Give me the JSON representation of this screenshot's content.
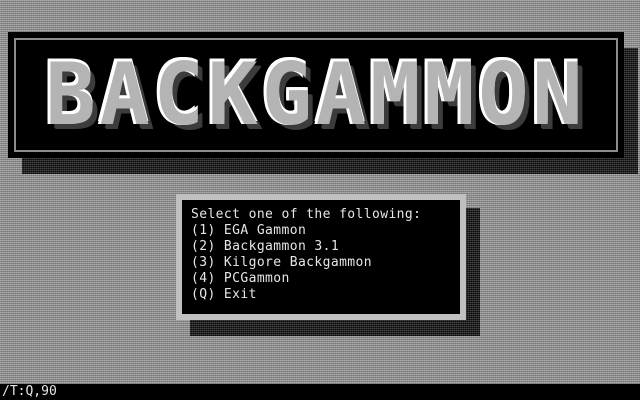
{
  "banner": {
    "title": "BACKGAMMON"
  },
  "menu": {
    "prompt": "Select one of the following:",
    "items": [
      {
        "label": "(1) EGA Gammon"
      },
      {
        "label": "(2) Backgammon 3.1"
      },
      {
        "label": "(3) Kilgore Backgammon"
      },
      {
        "label": "(4) PCGammon"
      },
      {
        "label": "(Q) Exit"
      }
    ]
  },
  "status": {
    "text": "/T:Q,90"
  },
  "colors": {
    "background": "#9a9a9a",
    "banner_letters": "#b4b4b4",
    "menu_frame": "#c0c0c0",
    "text": "#e6e6e6"
  }
}
